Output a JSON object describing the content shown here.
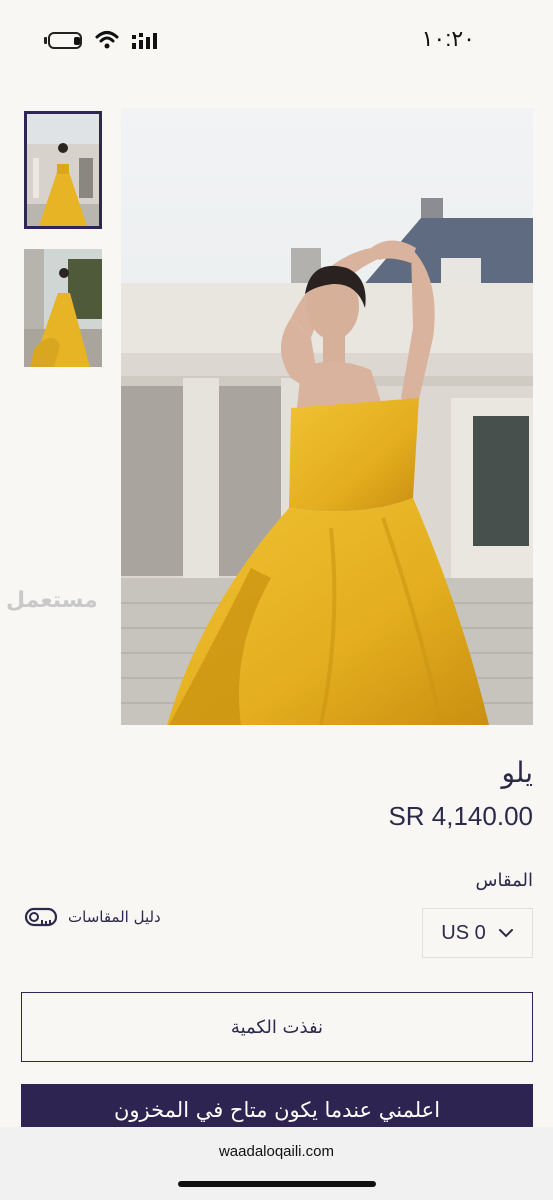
{
  "status": {
    "time": "١٠:٢٠"
  },
  "watermark": "مستعمل",
  "product": {
    "title": "يلو",
    "price": "SR 4,140.00"
  },
  "size": {
    "label": "المقاس",
    "selected": "US 0",
    "guide_label": "دليل المقاسات"
  },
  "actions": {
    "sold_out": "نفذت الكمية",
    "notify": "اعلمني عندما يكون متاح في المخزون"
  },
  "browser": {
    "url": "waadaloqaili.com"
  },
  "colors": {
    "accent": "#2d2451",
    "dress": "#e6b425"
  }
}
